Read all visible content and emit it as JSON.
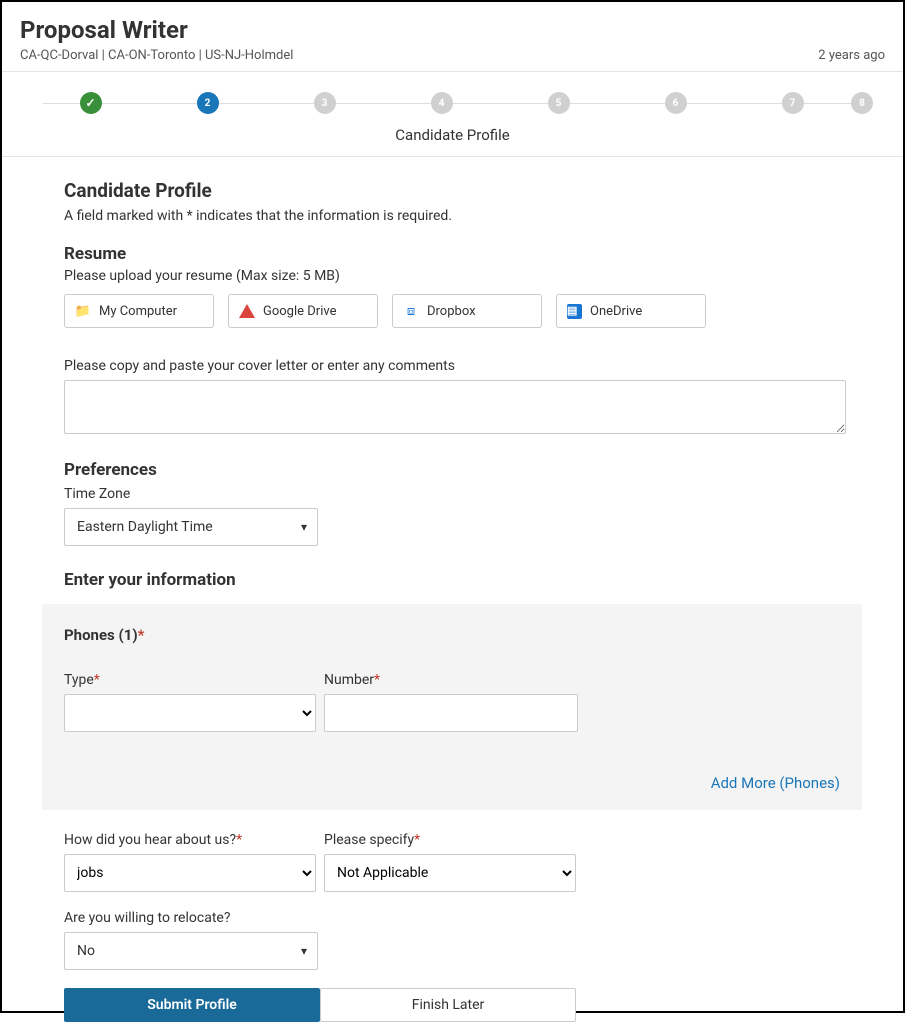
{
  "header": {
    "title": "Proposal Writer",
    "locations": "CA-QC-Dorval | CA-ON-Toronto | US-NJ-Holmdel",
    "posted": "2 years ago"
  },
  "stepper": {
    "steps": [
      "",
      "2",
      "3",
      "4",
      "5",
      "6",
      "7",
      "8"
    ],
    "active_index": 1,
    "current_label": "Candidate Profile"
  },
  "profile": {
    "heading": "Candidate Profile",
    "required_note": "A field marked with * indicates that the information is required."
  },
  "resume": {
    "heading": "Resume",
    "hint": "Please upload your resume (Max size: 5 MB)",
    "sources": {
      "my_computer": "My Computer",
      "google_drive": "Google Drive",
      "dropbox": "Dropbox",
      "onedrive": "OneDrive"
    }
  },
  "cover_letter": {
    "label": "Please copy and paste your cover letter or enter any comments",
    "value": ""
  },
  "preferences": {
    "heading": "Preferences",
    "timezone_label": "Time Zone",
    "timezone_value": "Eastern Daylight Time"
  },
  "info": {
    "heading": "Enter your information"
  },
  "phones": {
    "heading": "Phones (1)",
    "type_label": "Type",
    "number_label": "Number",
    "type_value": "",
    "number_value": "",
    "add_more": "Add More (Phones)"
  },
  "questions": {
    "hear_label": "How did you hear about us?",
    "hear_value": "jobs",
    "specify_label": "Please specify",
    "specify_value": "Not Applicable",
    "relocate_label": "Are you willing to relocate?",
    "relocate_value": "No"
  },
  "buttons": {
    "submit": "Submit Profile",
    "later": "Finish Later"
  }
}
